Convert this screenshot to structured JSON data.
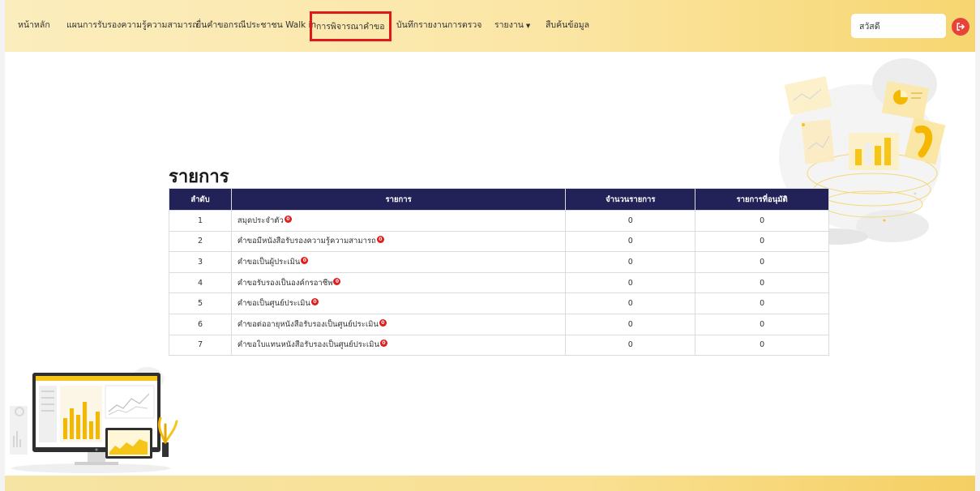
{
  "nav": {
    "items": [
      {
        "label": "หน้าหลัก"
      },
      {
        "label": "แผนการรับรองความรู้ความสามารถ"
      },
      {
        "label": "ยื่นคำขอกรณีประชาชน Walk in"
      },
      {
        "label": "การพิจารณาคำขอ"
      },
      {
        "label": "บันทึกรายงานการตรวจ"
      },
      {
        "label": "รายงาน"
      },
      {
        "label": "สืบค้นข้อมูล"
      }
    ],
    "greeting": "สวัสดี",
    "logout_icon": "logout-icon"
  },
  "page": {
    "title": "รายการ"
  },
  "table": {
    "headers": {
      "num": "ลำดับ",
      "name": "รายการ",
      "count": "จำนวนรายการ",
      "approved": "รายการที่อนุมัติ"
    },
    "rows": [
      {
        "num": "1",
        "name": "สมุดประจำตัว",
        "badge": "0",
        "count": "0",
        "approved": "0"
      },
      {
        "num": "2",
        "name": "คำขอมีหนังสือรับรองความรู้ความสามารถ",
        "badge": "0",
        "count": "0",
        "approved": "0"
      },
      {
        "num": "3",
        "name": "คำขอเป็นผู้ประเมิน",
        "badge": "0",
        "count": "0",
        "approved": "0"
      },
      {
        "num": "4",
        "name": "คำขอรับรองเป็นองค์กรอาชีพ",
        "badge": "0",
        "count": "0",
        "approved": "0"
      },
      {
        "num": "5",
        "name": "คำขอเป็นศูนย์ประเมิน",
        "badge": "0",
        "count": "0",
        "approved": "0"
      },
      {
        "num": "6",
        "name": "คำขอต่ออายุหนังสือรับรองเป็นศูนย์ประเมิน",
        "badge": "0",
        "count": "0",
        "approved": "0"
      },
      {
        "num": "7",
        "name": "คำขอใบแทนหนังสือรับรองเป็นศูนย์ประเมิน",
        "badge": "0",
        "count": "0",
        "approved": "0"
      }
    ]
  },
  "colors": {
    "header_bg": "#232258",
    "highlight_border": "#e01818",
    "badge": "#e21b1b",
    "accent_yellow": "#f5c518"
  }
}
